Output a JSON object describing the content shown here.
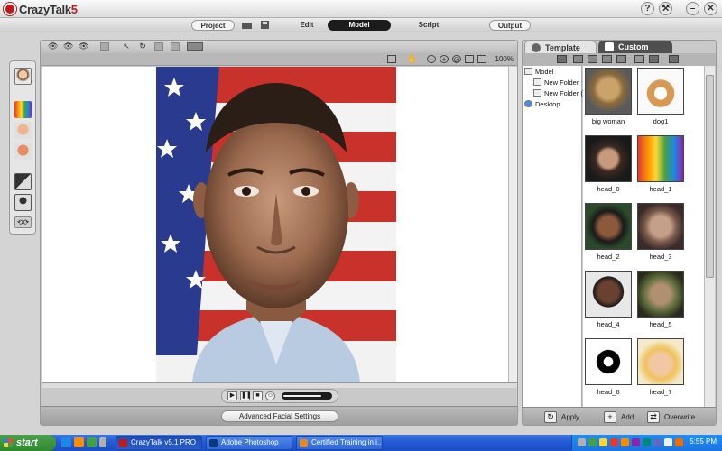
{
  "app": {
    "logo_text": "CrazyTalk",
    "logo_version": "5",
    "title_buttons": [
      "?",
      "⚒",
      "–",
      "✕"
    ]
  },
  "modes": {
    "project": "Project",
    "edit": "Edit",
    "model": "Model",
    "script": "Script",
    "output": "Output",
    "active": "Model"
  },
  "viewport": {
    "zoom": "100%",
    "advanced_button": "Advanced Facial Settings",
    "volume_level": 0.8
  },
  "panel": {
    "tabs": [
      {
        "label": "Template"
      },
      {
        "label": "Custom"
      }
    ],
    "active_tab": "Custom",
    "tree": [
      {
        "label": "Model"
      },
      {
        "label": "New Folder"
      },
      {
        "label": "New Folder ("
      },
      {
        "label": "Desktop"
      }
    ],
    "items": [
      {
        "label": "big woman"
      },
      {
        "label": "dog1"
      },
      {
        "label": "head_0"
      },
      {
        "label": "head_1"
      },
      {
        "label": "head_2"
      },
      {
        "label": "head_3"
      },
      {
        "label": "head_4"
      },
      {
        "label": "head_5"
      },
      {
        "label": "head_6"
      },
      {
        "label": "head_7"
      }
    ],
    "bottom_buttons": {
      "apply": "Apply",
      "add": "Add",
      "overwrite": "Overwrite"
    }
  },
  "taskbar": {
    "start": "start",
    "tasks": [
      {
        "label": "CrazyTalk v5.1 PRO"
      },
      {
        "label": "Adobe Photoshop"
      },
      {
        "label": "Certified Training in i..."
      }
    ],
    "clock": "5:55 PM"
  },
  "colors": {
    "accent_red": "#c21818",
    "taskbar_blue": "#245ad4",
    "start_green": "#2f8a2f",
    "active_mode": "#1c1c1c"
  }
}
